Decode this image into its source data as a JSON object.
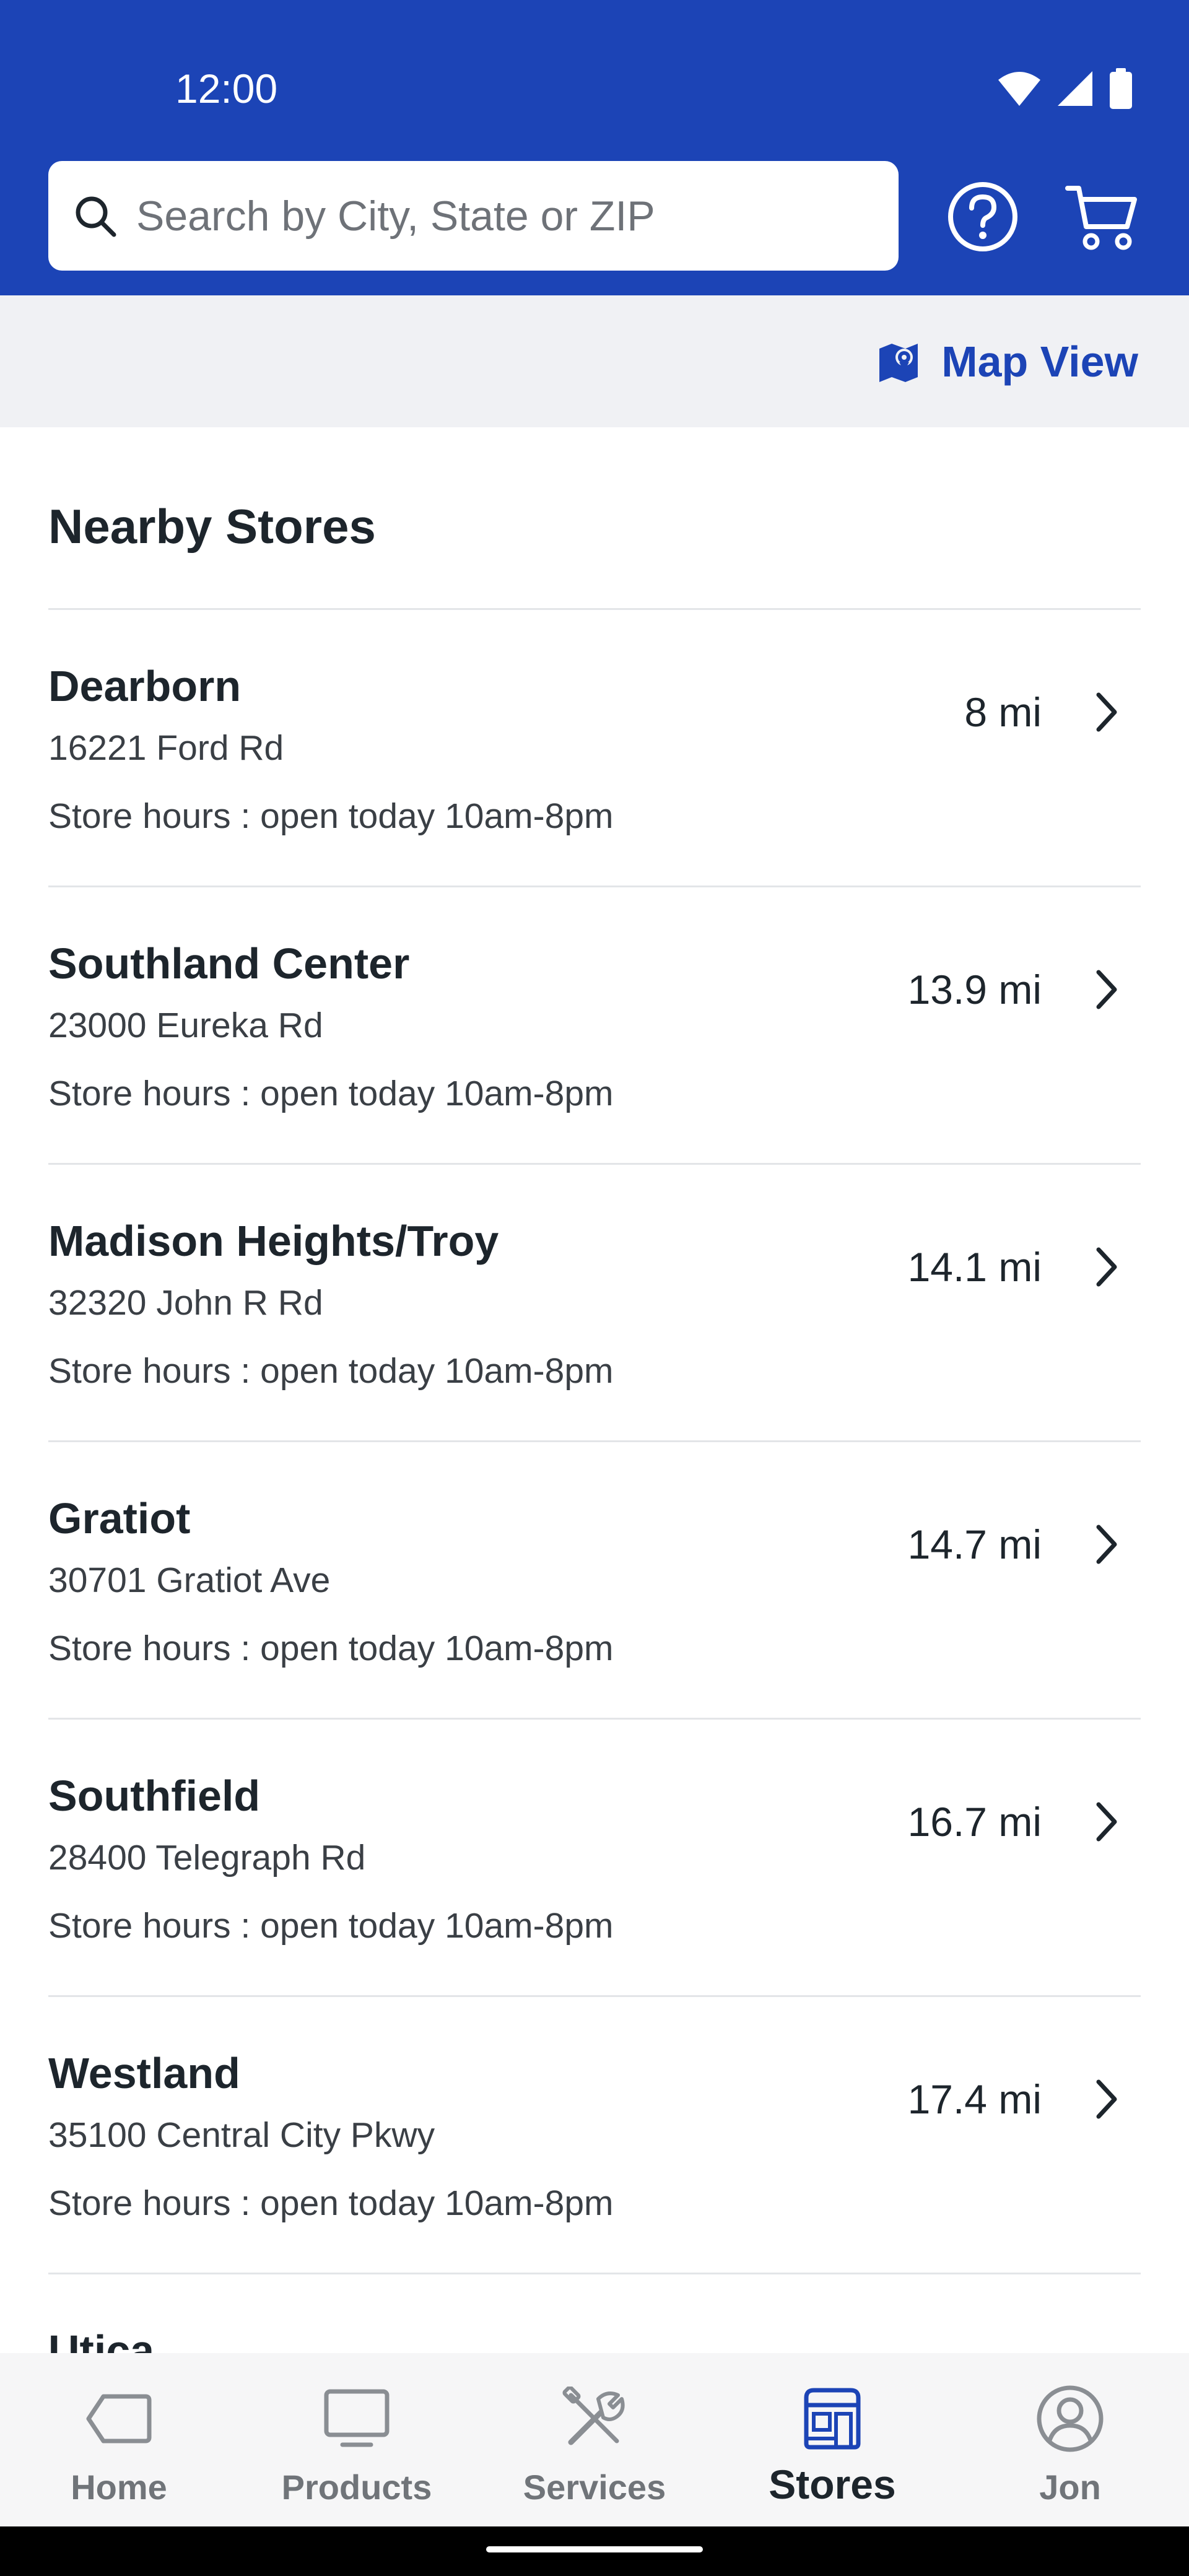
{
  "status_bar": {
    "time": "12:00"
  },
  "search": {
    "placeholder": "Search by City, State or ZIP",
    "value": ""
  },
  "header_icons": [
    "help-icon",
    "cart-icon"
  ],
  "map_view": {
    "label": "Map View"
  },
  "section": {
    "title": "Nearby Stores"
  },
  "stores": [
    {
      "name": "Dearborn",
      "address": "16221 Ford Rd",
      "hours": "Store hours : open today 10am-8pm",
      "distance": "8 mi"
    },
    {
      "name": "Southland Center",
      "address": "23000 Eureka Rd",
      "hours": "Store hours : open today 10am-8pm",
      "distance": "13.9 mi"
    },
    {
      "name": "Madison Heights/Troy",
      "address": "32320 John R Rd",
      "hours": "Store hours : open today 10am-8pm",
      "distance": "14.1 mi"
    },
    {
      "name": "Gratiot",
      "address": "30701 Gratiot Ave",
      "hours": "Store hours : open today 10am-8pm",
      "distance": "14.7 mi"
    },
    {
      "name": "Southfield",
      "address": "28400 Telegraph Rd",
      "hours": "Store hours : open today 10am-8pm",
      "distance": "16.7 mi"
    },
    {
      "name": "Westland",
      "address": "35100 Central City Pkwy",
      "hours": "Store hours : open today 10am-8pm",
      "distance": "17.4 mi"
    },
    {
      "name": "Utica"
    }
  ],
  "bottom_nav": [
    {
      "label": "Home",
      "icon": "tag-icon",
      "active": false
    },
    {
      "label": "Products",
      "icon": "monitor-icon",
      "active": false
    },
    {
      "label": "Services",
      "icon": "tools-icon",
      "active": false
    },
    {
      "label": "Stores",
      "icon": "store-icon",
      "active": true
    },
    {
      "label": "Jon",
      "icon": "user-icon",
      "active": false
    }
  ],
  "colors": {
    "brand_blue": "#1c44b6",
    "text_primary": "#1d252c",
    "nav_inactive": "#707479"
  }
}
